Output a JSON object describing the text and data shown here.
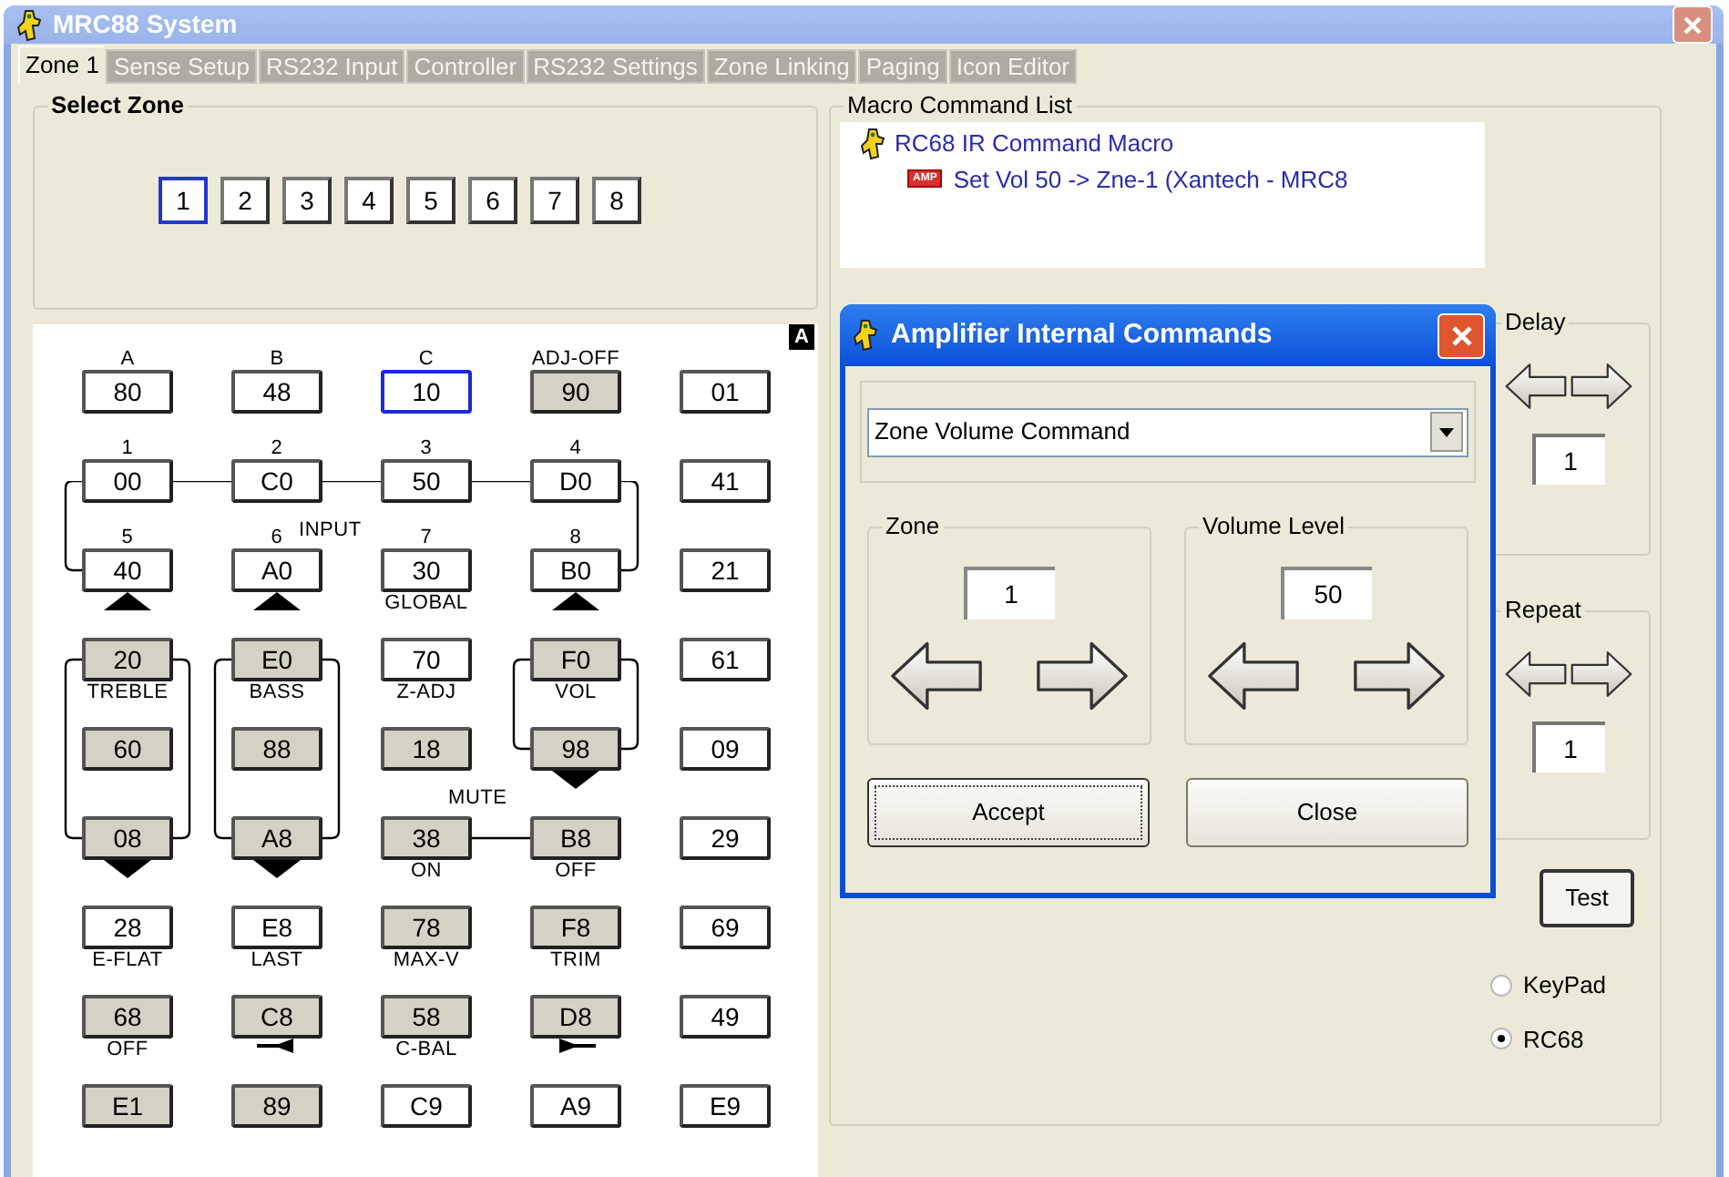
{
  "window": {
    "title": "MRC88 System"
  },
  "tabs": [
    {
      "label": "Zone 1",
      "selected": true
    },
    {
      "label": "Sense Setup",
      "selected": false
    },
    {
      "label": "RS232 Input",
      "selected": false
    },
    {
      "label": "Controller",
      "selected": false
    },
    {
      "label": "RS232 Settings",
      "selected": false
    },
    {
      "label": "Zone Linking",
      "selected": false
    },
    {
      "label": "Paging",
      "selected": false
    },
    {
      "label": "Icon Editor",
      "selected": false
    }
  ],
  "select_zone": {
    "title": "Select Zone",
    "zones": [
      {
        "label": "1",
        "selected": true
      },
      {
        "label": "2",
        "selected": false
      },
      {
        "label": "3",
        "selected": false
      },
      {
        "label": "4",
        "selected": false
      },
      {
        "label": "5",
        "selected": false
      },
      {
        "label": "6",
        "selected": false
      },
      {
        "label": "7",
        "selected": false
      },
      {
        "label": "8",
        "selected": false
      }
    ]
  },
  "keypad": {
    "badge": "A",
    "rows": [
      [
        {
          "code": "80",
          "above": "A",
          "shaded": false,
          "selected": false
        },
        {
          "code": "48",
          "above": "B",
          "shaded": false,
          "selected": false
        },
        {
          "code": "10",
          "above": "C",
          "shaded": false,
          "selected": true
        },
        {
          "code": "90",
          "above": "ADJ-OFF",
          "shaded": true,
          "selected": false
        },
        {
          "code": "01",
          "shaded": false,
          "selected": false
        }
      ],
      [
        {
          "code": "00",
          "above": "1",
          "shaded": false,
          "selected": false
        },
        {
          "code": "C0",
          "above": "2",
          "shaded": false,
          "selected": false
        },
        {
          "code": "50",
          "above": "3",
          "shaded": false,
          "selected": false
        },
        {
          "code": "D0",
          "above": "4",
          "shaded": false,
          "selected": false
        },
        {
          "code": "41",
          "shaded": false,
          "selected": false
        }
      ],
      [
        {
          "code": "40",
          "above": "5",
          "shaded": false,
          "selected": false,
          "kind": "up"
        },
        {
          "code": "A0",
          "above": "6",
          "tag": "INPUT",
          "shaded": false,
          "selected": false,
          "kind": "up"
        },
        {
          "code": "30",
          "above": "7",
          "below": "GLOBAL",
          "shaded": false,
          "selected": false
        },
        {
          "code": "B0",
          "above": "8",
          "shaded": false,
          "selected": false,
          "kind": "up"
        },
        {
          "code": "21",
          "shaded": false,
          "selected": false
        }
      ],
      [
        {
          "code": "20",
          "below": "TREBLE",
          "shaded": true,
          "selected": false
        },
        {
          "code": "E0",
          "below": "BASS",
          "shaded": true,
          "selected": false
        },
        {
          "code": "70",
          "below": "Z-ADJ",
          "shaded": false,
          "selected": false
        },
        {
          "code": "F0",
          "below": "VOL",
          "shaded": true,
          "selected": false
        },
        {
          "code": "61",
          "shaded": false,
          "selected": false
        }
      ],
      [
        {
          "code": "60",
          "shaded": true,
          "selected": false
        },
        {
          "code": "88",
          "shaded": true,
          "selected": false
        },
        {
          "code": "18",
          "shaded": true,
          "selected": false
        },
        {
          "code": "98",
          "shaded": true,
          "selected": false,
          "kind": "down"
        },
        {
          "code": "09",
          "shaded": false,
          "selected": false
        }
      ],
      [
        {
          "code": "08",
          "shaded": true,
          "selected": false,
          "kind": "down"
        },
        {
          "code": "A8",
          "shaded": true,
          "selected": false,
          "kind": "down"
        },
        {
          "code": "38",
          "tag": "MUTE",
          "below": "ON",
          "shaded": true,
          "selected": false
        },
        {
          "code": "B8",
          "below": "OFF",
          "shaded": true,
          "selected": false
        },
        {
          "code": "29",
          "shaded": false,
          "selected": false
        }
      ],
      [
        {
          "code": "28",
          "below": "E-FLAT",
          "shaded": false,
          "selected": false
        },
        {
          "code": "E8",
          "below": "LAST",
          "shaded": false,
          "selected": false
        },
        {
          "code": "78",
          "below": "MAX-V",
          "shaded": true,
          "selected": false
        },
        {
          "code": "F8",
          "below": "TRIM",
          "shaded": true,
          "selected": false
        },
        {
          "code": "69",
          "shaded": false,
          "selected": false
        }
      ],
      [
        {
          "code": "68",
          "below": "OFF",
          "shaded": true,
          "selected": false
        },
        {
          "code": "C8",
          "shaded": true,
          "selected": false,
          "kind": "speakerleft"
        },
        {
          "code": "58",
          "below": "C-BAL",
          "shaded": true,
          "selected": false
        },
        {
          "code": "D8",
          "shaded": true,
          "selected": false,
          "kind": "speakerright"
        },
        {
          "code": "49",
          "shaded": false,
          "selected": false
        }
      ],
      [
        {
          "code": "E1",
          "shaded": true,
          "selected": false
        },
        {
          "code": "89",
          "shaded": true,
          "selected": false
        },
        {
          "code": "C9",
          "shaded": false,
          "selected": false
        },
        {
          "code": "A9",
          "shaded": false,
          "selected": false
        },
        {
          "code": "E9",
          "shaded": false,
          "selected": false
        }
      ]
    ]
  },
  "macro_list": {
    "title": "Macro Command List",
    "tree": [
      {
        "label": "RC68 IR Command Macro",
        "children": [
          {
            "badge": "AMP",
            "label": "Set Vol 50 -> Zne-1 (Xantech - MRC8"
          }
        ]
      }
    ]
  },
  "delay": {
    "title": "Delay",
    "value": "1"
  },
  "repeat": {
    "title": "Repeat",
    "value": "1"
  },
  "test_button": "Test",
  "modes": [
    {
      "label": "KeyPad",
      "selected": false
    },
    {
      "label": "RC68",
      "selected": true
    }
  ],
  "dialog": {
    "title": "Amplifier Internal Commands",
    "command": "Zone Volume Command",
    "zone": {
      "title": "Zone",
      "value": "1"
    },
    "volume": {
      "title": "Volume Level",
      "value": "50"
    },
    "buttons": [
      {
        "label": "Accept",
        "focused": true
      },
      {
        "label": "Close",
        "focused": false
      }
    ]
  }
}
